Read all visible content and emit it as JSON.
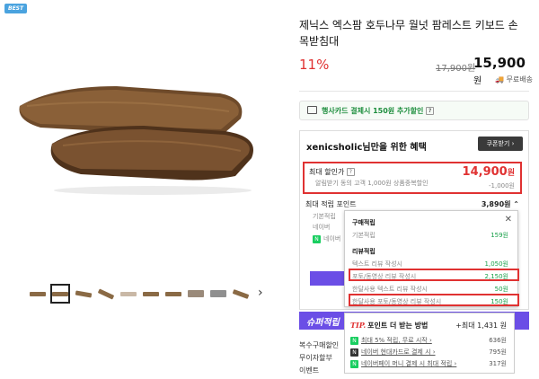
{
  "badge": "BEST",
  "product": {
    "title": "제닉스 엑스팜 호두나무 월넛 팜레스트 키보드 손목받침대",
    "discount": "11%",
    "original_price": "17,900원",
    "price": "15,900",
    "price_unit": "원",
    "shipping": "무료배송"
  },
  "card_promo": {
    "text": "행사카드 결제시 150원 추가할인",
    "help": "?"
  },
  "benefit": {
    "heading": "xenicsholic님만을 위한 혜택",
    "coupon_button": "쿠폰받기 ›",
    "max_discount_label": "최대 할인가",
    "max_discount_value": "14,900",
    "max_discount_unit": "원",
    "max_discount_sub": "알림받기 동의 고객 1,000원 상품중복할인",
    "max_discount_sub_value": "-1,000원",
    "points_label": "최대 적립 포인트",
    "points_value": "3,890원",
    "sub_rows": [
      "기본적립",
      "네이버",
      "네이버"
    ]
  },
  "popup": {
    "purchase_heading": "구매적립",
    "basic_label": "기본적립",
    "basic_value": "159원",
    "review_heading": "리뷰적립",
    "text_review_label": "텍스트 리뷰 작성시",
    "text_review_value": "1,050원",
    "photo_review_label": "포토/동영상 리뷰 작성시",
    "photo_review_value": "2,150원",
    "month_text_label": "한달사용 텍스트 리뷰 작성시",
    "month_text_value": "50원",
    "month_photo_label": "한달사용 포토/동영상 리뷰 작성시",
    "month_photo_value": "150원",
    "close": "✕"
  },
  "shuper_label": "슈퍼적립",
  "tip": {
    "tip_word": "TIP.",
    "heading": "포인트 더 받는 방법",
    "max_value": "+최대 1,431 원",
    "rows": [
      {
        "label": "최대 5% 적립, 무료 시작 ›",
        "value": "636원"
      },
      {
        "label": "네이버 현대카드로 결제 시 ›",
        "value": "795원"
      },
      {
        "label": "네이버페이 머니 결제 시 최대 적립 ›",
        "value": "317원"
      }
    ]
  },
  "bottom": [
    "복수구매할인",
    "무이자할부",
    "이벤트"
  ],
  "colors": {
    "accent": "#e03232",
    "green": "#19ce60",
    "purple": "#6b4ee6"
  }
}
